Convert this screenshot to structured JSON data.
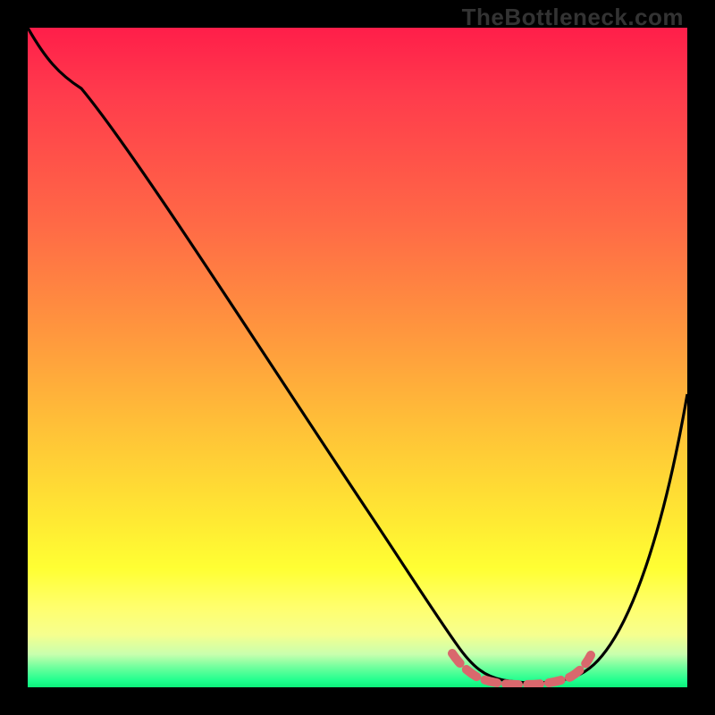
{
  "watermark": "TheBottleneck.com",
  "chart_data": {
    "type": "line",
    "title": "",
    "xlabel": "",
    "ylabel": "",
    "xlim": [
      0,
      100
    ],
    "ylim": [
      0,
      100
    ],
    "background_gradient_top": "#ff1e4a",
    "background_gradient_bottom": "#0cf07a",
    "series": [
      {
        "name": "curve",
        "color": "#000000",
        "x": [
          0,
          5,
          10,
          20,
          30,
          40,
          50,
          58,
          62,
          66,
          72,
          76,
          80,
          84,
          88,
          92,
          96,
          100
        ],
        "y": [
          100,
          96,
          92,
          80,
          66,
          52,
          37,
          22,
          14,
          7,
          2,
          1,
          1,
          2,
          8,
          20,
          35,
          52
        ]
      }
    ],
    "highlight": {
      "name": "trough",
      "color": "#d9686d",
      "x": [
        62,
        66,
        70,
        74,
        78,
        82,
        84
      ],
      "y": [
        4,
        2,
        1,
        1,
        1,
        2,
        3
      ]
    }
  }
}
